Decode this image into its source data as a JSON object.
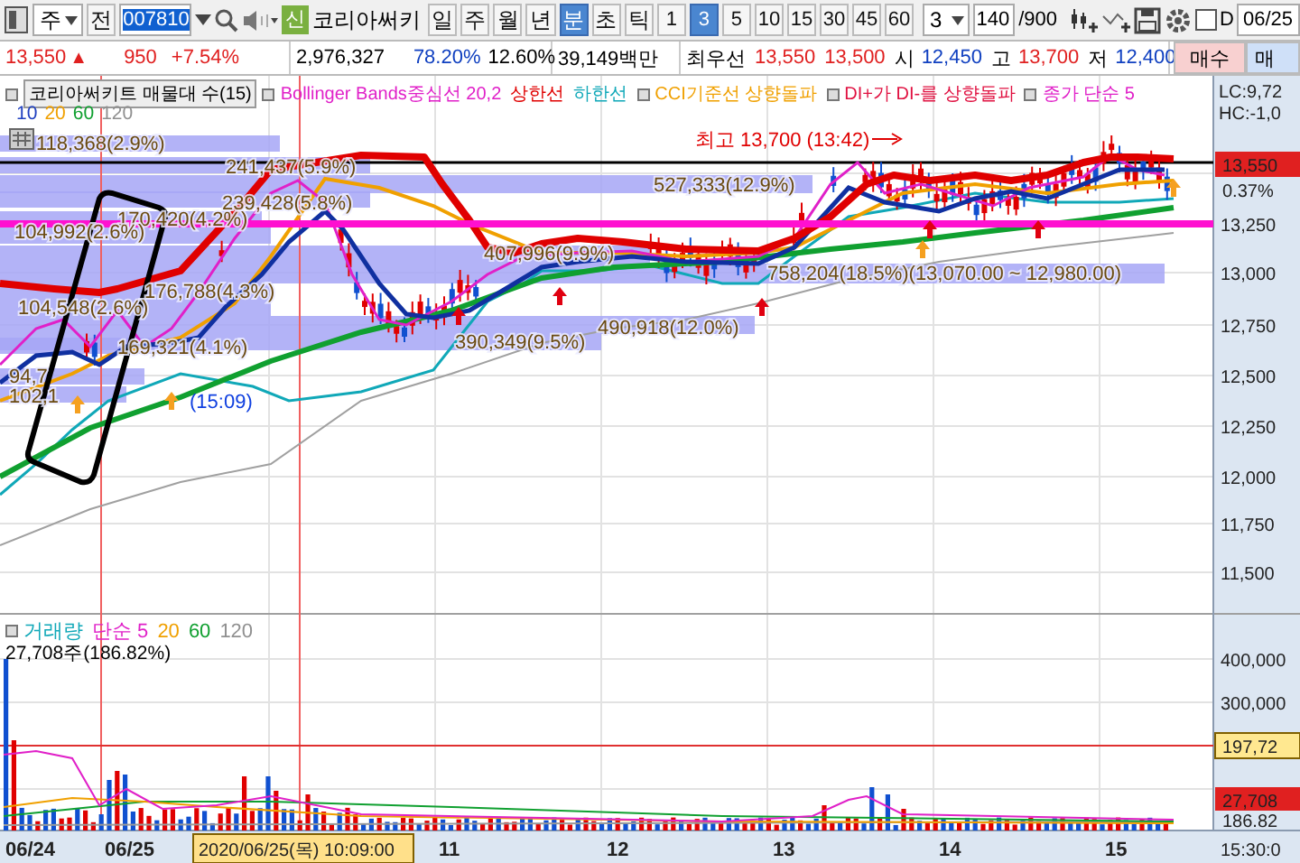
{
  "toolbar": {
    "market_select": {
      "value": "주"
    },
    "prev_button": "전",
    "code_field": {
      "value": "007810"
    },
    "logo_badge": "신",
    "company_name": "코리아써키",
    "period_buttons": [
      {
        "label": "일",
        "selected": false
      },
      {
        "label": "주",
        "selected": false
      },
      {
        "label": "월",
        "selected": false
      },
      {
        "label": "년",
        "selected": false
      },
      {
        "label": "분",
        "selected": true
      },
      {
        "label": "초",
        "selected": false
      },
      {
        "label": "틱",
        "selected": false
      }
    ],
    "interval_buttons": [
      {
        "label": "1",
        "selected": false
      },
      {
        "label": "3",
        "selected": true
      },
      {
        "label": "5",
        "selected": false
      },
      {
        "label": "10",
        "selected": false
      },
      {
        "label": "15",
        "selected": false
      },
      {
        "label": "30",
        "selected": false
      },
      {
        "label": "45",
        "selected": false
      },
      {
        "label": "60",
        "selected": false
      }
    ],
    "unit_select": {
      "value": "3"
    },
    "count_field": {
      "value": "140"
    },
    "count_total": "/900",
    "d_checkbox": {
      "label": "D",
      "checked": false
    },
    "date_field": {
      "value": "06/25"
    }
  },
  "quote_bar": {
    "price": "13,550",
    "change_arrow": "▲",
    "change": "950",
    "change_rate": "+7.54%",
    "volume": "2,976,327",
    "ratio": "78.20%",
    "turnover": "12.60%",
    "amount": "39,149백만",
    "best_label": "최우선",
    "best_ask": "13,550",
    "best_bid": "13,500",
    "open_label": "시",
    "open": "12,450",
    "high_label": "고",
    "high": "13,700",
    "low_label": "저",
    "low": "12,400",
    "buttons": [
      {
        "label": "매수",
        "kind": "buy"
      },
      {
        "label": "매",
        "kind": "sell"
      }
    ]
  },
  "price_chart": {
    "indicator_title": "코리아써키트 매물대 수(15)",
    "legend": [
      {
        "label": "Bollinger Bands중심선 20,2",
        "color": "#e020c8"
      },
      {
        "label": "상한선",
        "color": "#e00000"
      },
      {
        "label": "하한선",
        "color": "#10a8b8"
      },
      {
        "label": "CCI기준선 상향돌파",
        "color": "#f0a000"
      },
      {
        "label": "DI+가 DI-를 상향돌파",
        "color": "#e01040"
      },
      {
        "label": "종가 단순 5",
        "color": "#e020c8"
      }
    ],
    "ma_legend": [
      {
        "label": "10",
        "color": "#2040c0"
      },
      {
        "label": "20",
        "color": "#f0a000"
      },
      {
        "label": "60",
        "color": "#10a030"
      },
      {
        "label": "120",
        "color": "#909090"
      }
    ],
    "profile_labels": [
      "118,368(2.9%)",
      "241,437(5.9%)",
      "239,428(5.8%)",
      "170,420(4.2%)",
      "104,992(2.6%)",
      "176,788(4.3%)",
      "104,548(2.6%)",
      "169,321(4.1%)",
      "94,7",
      "102,1",
      "407,996(9.9%)",
      "390,349(9.5%)",
      "490,918(12.0%)",
      "527,333(12.9%)",
      "758,204(18.5%)(13,070.00 ~ 12,980.00)"
    ],
    "high_note": "최고 13,700 (13:42)",
    "low_note": "(15:09)",
    "axis_info": [
      "LC:9,72",
      "HC:-1,0"
    ],
    "y_ticks": [
      "13,250",
      "13,000",
      "12,750",
      "12,500",
      "12,250",
      "12,000",
      "11,750",
      "11,500"
    ],
    "current_price": "13,550",
    "current_change": "0.37%"
  },
  "volume_chart": {
    "legend": [
      {
        "label": "거래량",
        "color": "#10a8b8"
      },
      {
        "label": "단순 5",
        "color": "#e020c8"
      },
      {
        "label": "20",
        "color": "#f0a000"
      },
      {
        "label": "60",
        "color": "#10a030"
      },
      {
        "label": "120",
        "color": "#909090"
      }
    ],
    "last_volume": "27,708주(186.82%)",
    "y_ticks": [
      "400,000",
      "300,000"
    ],
    "avg_badge": "197,72",
    "current_badge": "27,708",
    "current_rate": "186.82"
  },
  "x_axis": {
    "labels": [
      "06/24",
      "06/25",
      "11",
      "12",
      "13",
      "14",
      "15"
    ],
    "cursor_time": "2020/06/25(목) 10:09:00",
    "end_label": "15:30:0"
  }
}
